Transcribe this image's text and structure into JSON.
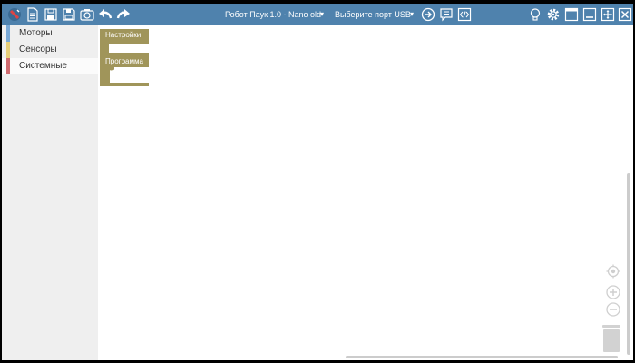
{
  "toolbar": {
    "robot_select": "Робот Паук 1.0 - Nano old",
    "port_select": "Выберите порт USB",
    "dropdown_arrow": "▾",
    "icons": [
      "logo-icon",
      "new-file-icon",
      "open-file-icon",
      "save-icon",
      "screenshot-icon",
      "undo-icon",
      "redo-icon",
      "upload-icon",
      "monitor-icon",
      "code-icon",
      "lightbulb-icon",
      "gear-icon",
      "window-icon",
      "minimize-icon",
      "fullscreen-icon",
      "close-icon"
    ]
  },
  "sidebar": {
    "categories": [
      {
        "label": "Моторы",
        "color": "#7aa9d6"
      },
      {
        "label": "Сенсоры",
        "color": "#e8cf79"
      },
      {
        "label": "Системные",
        "color": "#d06b6f"
      }
    ]
  },
  "workspace": {
    "blocks": [
      {
        "label": "Настройки",
        "color": "#a0955a"
      },
      {
        "label": "Программа",
        "color": "#a0955a"
      }
    ]
  }
}
